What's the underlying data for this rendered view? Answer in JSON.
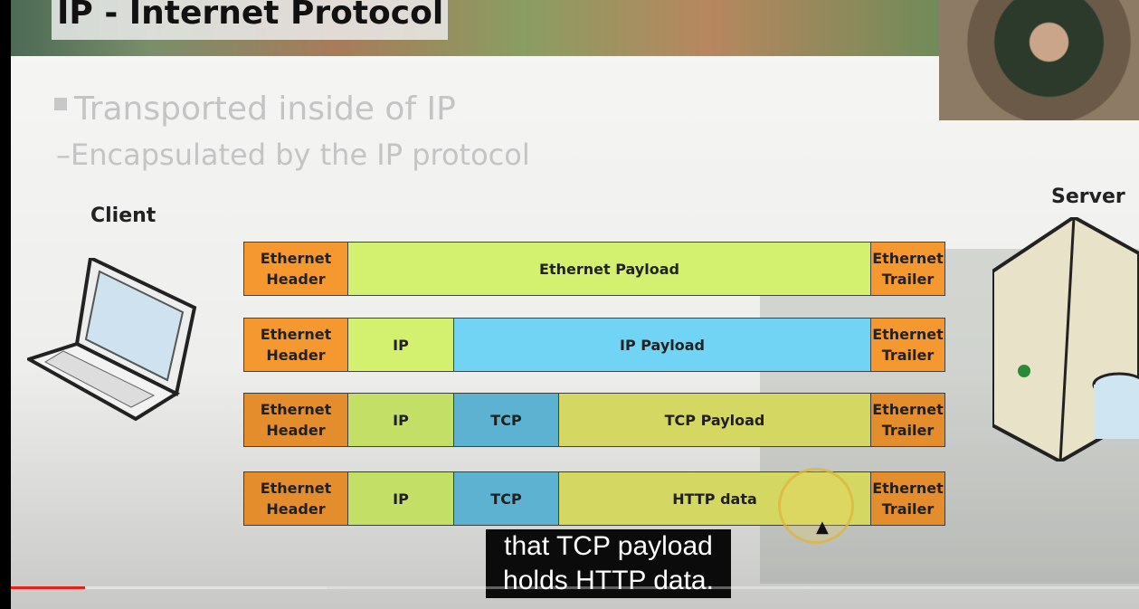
{
  "slide": {
    "title": "IP - Internet Protocol",
    "bullet1": "Transported inside of IP",
    "bullet2": "–Encapsulated by the IP protocol",
    "client_label": "Client",
    "server_label": "Server"
  },
  "rows": [
    [
      "Ethernet Header",
      "Ethernet Payload",
      "Ethernet Trailer"
    ],
    [
      "Ethernet Header",
      "IP",
      "IP Payload",
      "Ethernet Trailer"
    ],
    [
      "Ethernet Header",
      "IP",
      "TCP",
      "TCP Payload",
      "Ethernet Trailer"
    ],
    [
      "Ethernet Header",
      "IP",
      "TCP",
      "HTTP data",
      "Ethernet Trailer"
    ]
  ],
  "caption": {
    "line1": "that TCP payload",
    "line2": "holds HTTP data."
  },
  "player": {
    "progress_percent": 6.6,
    "accent": "#e62117"
  }
}
